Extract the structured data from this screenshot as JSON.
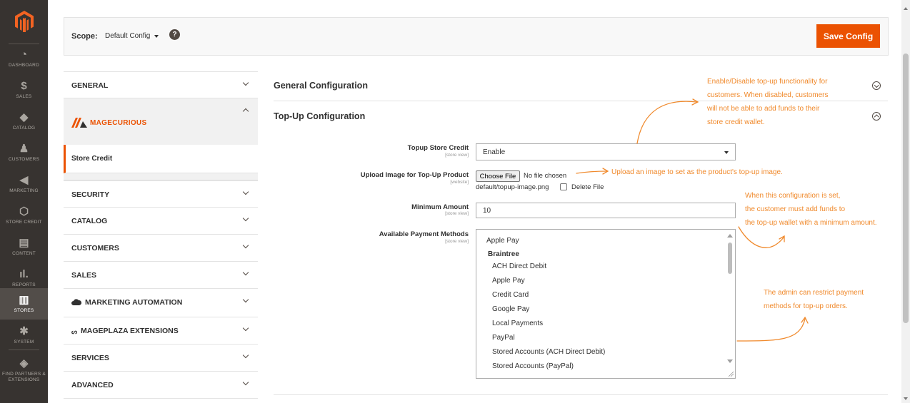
{
  "sidebar": {
    "logo_icon": "magento-logo-icon",
    "items": [
      {
        "label": "DASHBOARD",
        "icon": "dashboard-icon"
      },
      {
        "label": "SALES",
        "icon": "dollar-icon"
      },
      {
        "label": "CATALOG",
        "icon": "box-icon"
      },
      {
        "label": "CUSTOMERS",
        "icon": "person-icon"
      },
      {
        "label": "MARKETING",
        "icon": "megaphone-icon"
      },
      {
        "label": "STORE CREDIT",
        "icon": "hexagon-icon"
      },
      {
        "label": "CONTENT",
        "icon": "layout-icon"
      },
      {
        "label": "REPORTS",
        "icon": "bar-chart-icon"
      },
      {
        "label": "STORES",
        "icon": "store-icon"
      },
      {
        "label": "SYSTEM",
        "icon": "gear-icon"
      },
      {
        "label": "FIND PARTNERS & EXTENSIONS",
        "icon": "cube-icon"
      }
    ],
    "active": "STORES"
  },
  "scopebar": {
    "scope_label": "Scope:",
    "scope_value": "Default Config",
    "help_icon": "?",
    "save_label": "Save Config"
  },
  "tabs": {
    "general": "GENERAL",
    "magecurious_brand": "MAGECURIOUS",
    "store_credit": "Store Credit",
    "security": "SECURITY",
    "catalog": "CATALOG",
    "customers": "CUSTOMERS",
    "sales": "SALES",
    "marketing_automation": "MARKETING AUTOMATION",
    "mageplaza_extensions": "MAGEPLAZA EXTENSIONS",
    "services": "SERVICES",
    "advanced": "ADVANCED"
  },
  "sections": {
    "general_configuration": "General Configuration",
    "topup_configuration": "Top-Up Configuration"
  },
  "fields": {
    "topup_store_credit": {
      "label": "Topup Store Credit",
      "scope": "[store view]",
      "value": "Enable"
    },
    "upload_image": {
      "label": "Upload Image for Top-Up Product",
      "scope": "[website]",
      "button": "Choose File",
      "status": "No file chosen",
      "path": "default/topup-image.png",
      "delete_label": "Delete File"
    },
    "minimum_amount": {
      "label": "Minimum Amount",
      "scope": "[store view]",
      "value": "10"
    },
    "payment_methods": {
      "label": "Available Payment Methods",
      "scope": "[store view]",
      "options": {
        "apple_pay_top": "Apple Pay",
        "braintree_group": "Braintree",
        "ach": "ACH Direct Debit",
        "apple_pay": "Apple Pay",
        "credit_card": "Credit Card",
        "google_pay": "Google Pay",
        "local_payments": "Local Payments",
        "paypal": "PayPal",
        "stored_ach": "Stored Accounts (ACH Direct Debit)",
        "stored_paypal": "Stored Accounts (PayPal)"
      }
    }
  },
  "annotations": {
    "enable": [
      "Enable/Disable top-up functionality for",
      "customers. When disabled, customers",
      "will not be able to add funds to their",
      "store credit wallet."
    ],
    "upload": "Upload an image to set as the product's top-up image.",
    "minimum": [
      "When this configuration is set,",
      "the customer must add funds to",
      "the top-up wallet with a minimum amount."
    ],
    "payment": [
      "The admin can restrict payment",
      "methods for top-up orders."
    ]
  },
  "colors": {
    "accent": "#eb5202",
    "annotation": "#f0892b",
    "sidebar_bg": "#373330"
  }
}
